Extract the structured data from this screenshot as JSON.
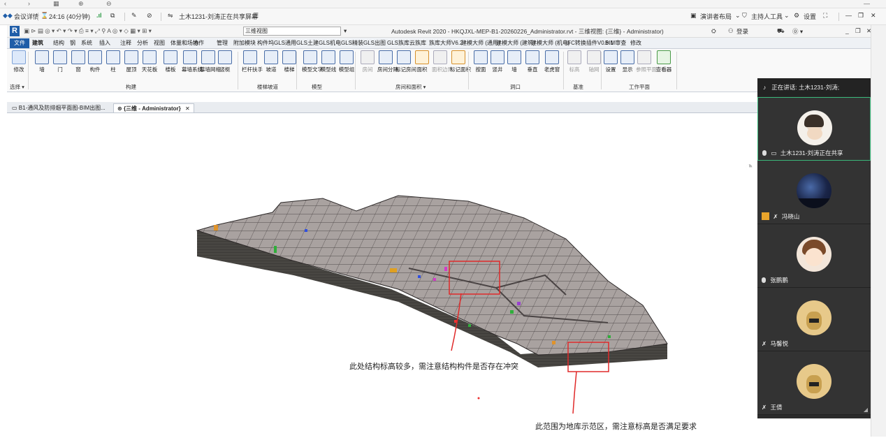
{
  "meeting_bar": {
    "details_label": "会议详情",
    "timer": "24:16 (40分钟)",
    "share_status": "土木1231-刘涛正在共享屏幕",
    "presenter_layout": "演讲者布局",
    "host_tools": "主持人工具",
    "settings": "设置"
  },
  "revit": {
    "window_title": "Autodesk Revit 2020 - HKQJXL-MEP-B1-20260226_Administrator.rvt - 三维视图: {三维} - Administrator)",
    "login": "登录",
    "view_combo": "三维视图",
    "tabs": [
      "文件",
      "建筑",
      "结构",
      "钢",
      "系统",
      "插入",
      "注释",
      "分析",
      "视图",
      "体量和场地",
      "协作",
      "管理",
      "附加模块",
      "构件坞",
      "GLS通用",
      "GLS土建",
      "GLS机电",
      "GLS精装",
      "GLS出图",
      "GLS族库",
      "云族库",
      "族库大师V6.2",
      "建模大师 (通用)",
      "建模大师 (建筑)",
      "建模大师 (机电)",
      "IFC转换插件V0.9.1",
      "BIM审查",
      "修改"
    ],
    "active_tab": "建筑",
    "ribbon_buttons": [
      {
        "label": "修改",
        "style": "select"
      },
      {
        "label": "墙",
        "style": "normal"
      },
      {
        "label": "门",
        "style": "normal"
      },
      {
        "label": "窗",
        "style": "normal"
      },
      {
        "label": "构件",
        "style": "normal"
      },
      {
        "label": "柱",
        "style": "normal"
      },
      {
        "label": "屋顶",
        "style": "normal"
      },
      {
        "label": "天花板",
        "style": "normal"
      },
      {
        "label": "楼板",
        "style": "normal"
      },
      {
        "label": "幕墙系统",
        "style": "normal"
      },
      {
        "label": "幕墙网格",
        "style": "normal"
      },
      {
        "label": "竖梃",
        "style": "normal"
      },
      {
        "label": "栏杆扶手",
        "style": "normal"
      },
      {
        "label": "坡道",
        "style": "normal"
      },
      {
        "label": "楼梯",
        "style": "normal"
      },
      {
        "label": "模型文字",
        "style": "normal"
      },
      {
        "label": "模型线",
        "style": "normal"
      },
      {
        "label": "模型组",
        "style": "normal"
      },
      {
        "label": "房间",
        "style": "dim"
      },
      {
        "label": "房间分隔",
        "style": "normal"
      },
      {
        "label": "标记房间",
        "style": "normal"
      },
      {
        "label": "面积",
        "style": "orange"
      },
      {
        "label": "面积边界",
        "style": "dim"
      },
      {
        "label": "标记面积",
        "style": "orange"
      },
      {
        "label": "按面",
        "style": "normal"
      },
      {
        "label": "竖井",
        "style": "normal"
      },
      {
        "label": "墙",
        "style": "normal"
      },
      {
        "label": "垂直",
        "style": "normal"
      },
      {
        "label": "老虎窗",
        "style": "normal"
      },
      {
        "label": "标高",
        "style": "dim"
      },
      {
        "label": "轴网",
        "style": "dim"
      },
      {
        "label": "设置",
        "style": "normal"
      },
      {
        "label": "显示",
        "style": "normal"
      },
      {
        "label": "参照平面",
        "style": "dim"
      },
      {
        "label": "查看器",
        "style": "green"
      }
    ],
    "panels": [
      "选择 ▾",
      "构建",
      "楼梯坡道",
      "模型",
      "房间和面积 ▾",
      "洞口",
      "基准",
      "工作平面"
    ],
    "doc_tabs": [
      "B1-通风及防排烟平面图-BIM出图...",
      "{三维 - Administrator}"
    ]
  },
  "annotations": {
    "note1": "此处结构标高较多，需注意结构构件是否存在冲突",
    "note2": "此范围为地库示范区，需注意标高是否满足要求"
  },
  "participants": {
    "speaking": "正在讲话: 土木1231-刘涛;",
    "list": [
      {
        "name": "土木1231-刘涛正在共享",
        "avatar": "photo-boy"
      },
      {
        "name": "冯晓山",
        "avatar": "starry-sky"
      },
      {
        "name": "张鹏鹏",
        "avatar": "cartoon-boy"
      },
      {
        "name": "马馨悦",
        "avatar": "cartoon-dog"
      },
      {
        "name": "王倩",
        "avatar": "cartoon-dog"
      }
    ]
  }
}
